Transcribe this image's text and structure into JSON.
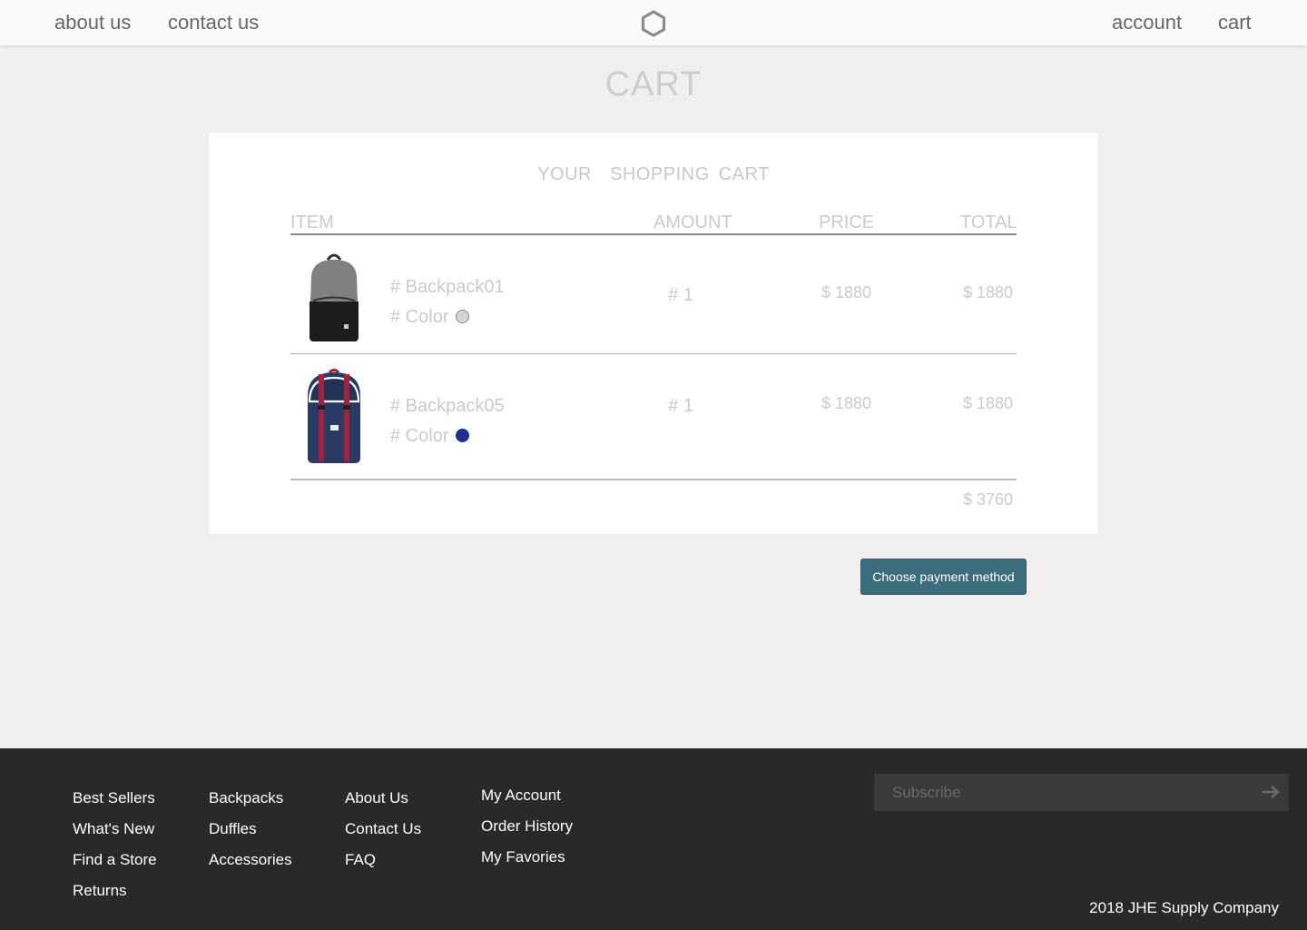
{
  "nav": {
    "left_links": [
      "about us",
      "contact us"
    ],
    "right_links": [
      "account",
      "cart"
    ],
    "logo_icon": "hexagon-logo-icon"
  },
  "page_title": "CART",
  "cart": {
    "title": "YOUR  SHOPPING CART",
    "headers": {
      "item": "ITEM",
      "amount": "AMOUNT",
      "price": "PRICE",
      "total": "TOTAL"
    },
    "items": [
      {
        "name": "# Backpack01",
        "color_label": "# Color",
        "color": "#d4d4d4",
        "amount": "# 1",
        "price": "$ 1880",
        "total": "$ 1880",
        "image_icon": "grey-black-backpack-image"
      },
      {
        "name": "# Backpack05",
        "color_label": "# Color",
        "color": "#1d2f8f",
        "amount": "# 1",
        "price": "$ 1880",
        "total": "$ 1880",
        "image_icon": "navy-red-backpack-image"
      }
    ],
    "grand_total": "$ 3760"
  },
  "pay_button": "Choose payment method",
  "footer": {
    "col1": [
      "Best Sellers",
      "What's New",
      "Find a Store",
      "Returns"
    ],
    "col2": [
      "Backpacks",
      "Duffles",
      "Accessories"
    ],
    "col3": [
      "About Us",
      "Contact Us",
      "FAQ"
    ],
    "col4": [
      "My Account",
      "Order History",
      "My Favories"
    ],
    "subscribe_placeholder": "Subscribe",
    "subscribe_icon": "arrow-right-icon",
    "copyright": "2018 JHE Supply Company"
  }
}
